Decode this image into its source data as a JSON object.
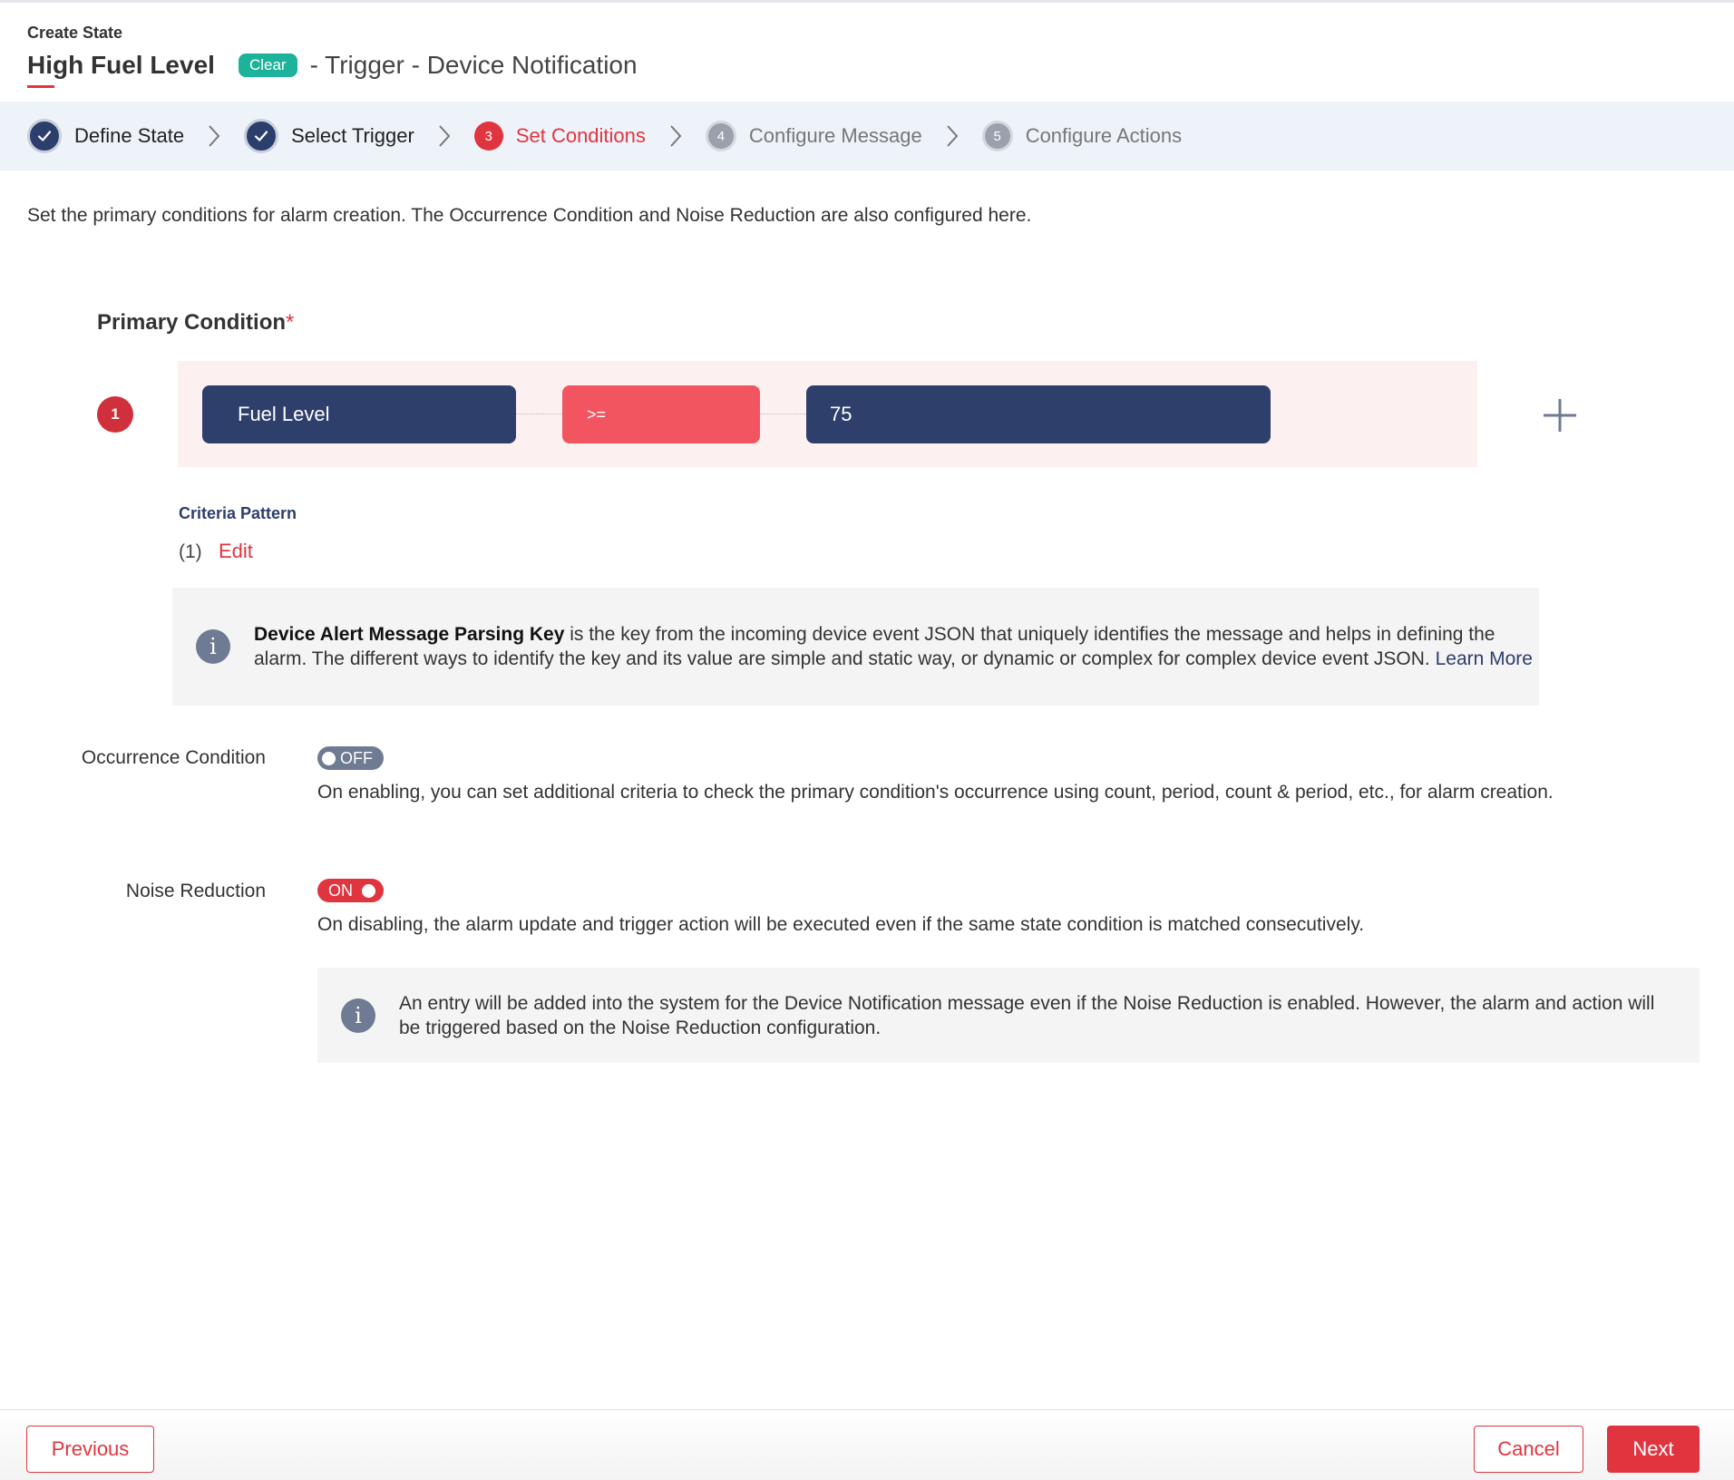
{
  "header": {
    "subtitle": "Create State",
    "title": "High Fuel Level",
    "badge": "Clear",
    "title_suffix": "- Trigger - Device Notification"
  },
  "stepper": {
    "steps": [
      {
        "number": "1",
        "label": "Define State",
        "status": "done"
      },
      {
        "number": "2",
        "label": "Select Trigger",
        "status": "done"
      },
      {
        "number": "3",
        "label": "Set Conditions",
        "status": "active"
      },
      {
        "number": "4",
        "label": "Configure Message",
        "status": "todo"
      },
      {
        "number": "5",
        "label": "Configure Actions",
        "status": "todo"
      }
    ]
  },
  "description": "Set the primary conditions for alarm creation. The Occurrence Condition and Noise Reduction are also configured here.",
  "primary_condition": {
    "label": "Primary Condition",
    "required_mark": "*",
    "conditions": [
      {
        "index": "1",
        "attribute": "Fuel Level",
        "operator": ">=",
        "value": "75"
      }
    ],
    "criteria_label": "Criteria Pattern",
    "criteria_value": "(1)",
    "edit_label": "Edit"
  },
  "info_parsing_key": {
    "icon": "info-icon",
    "bold": "Device Alert Message Parsing Key",
    "text": " is the key from the incoming device event JSON that uniquely identifies the message and helps in defining the alarm. The different ways to identify the key and its value are simple and static way, or dynamic or complex for complex device event JSON. ",
    "link": "Learn More"
  },
  "occurrence": {
    "label": "Occurrence Condition",
    "toggle_text": "OFF",
    "enabled": false,
    "description": "On enabling, you can set additional criteria to check the primary condition's occurrence using count, period, count & period, etc., for alarm creation."
  },
  "noise_reduction": {
    "label": "Noise Reduction",
    "toggle_text": "ON",
    "enabled": true,
    "description": "On disabling, the alarm update and trigger action will be executed even if the same state condition is matched consecutively.",
    "info": "An entry will be added into the system for the Device Notification message even if the Noise Reduction is enabled. However, the alarm and action will be triggered based on the Noise Reduction configuration."
  },
  "footer": {
    "previous_label": "Previous",
    "cancel_label": "Cancel",
    "next_label": "Next"
  },
  "colors": {
    "accent": "#e0353f",
    "navy": "#2e3f6c",
    "badge_green": "#1db39a",
    "stepper_bg": "#eef3fa"
  }
}
